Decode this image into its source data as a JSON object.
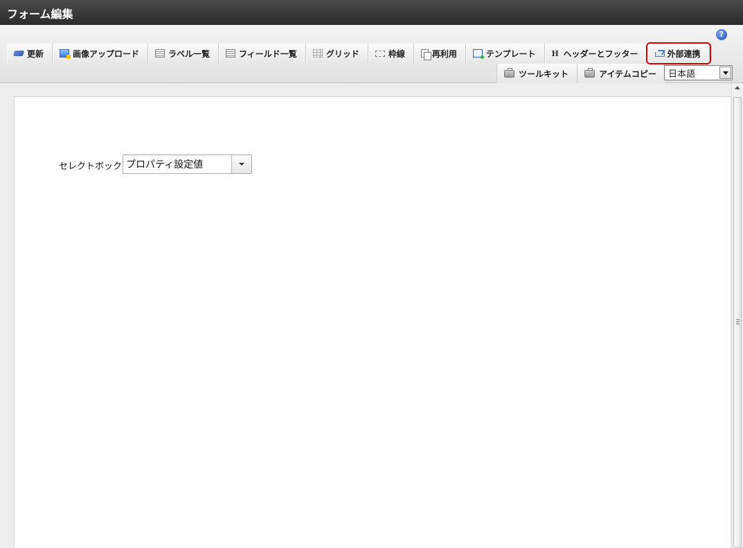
{
  "window": {
    "title": "フォーム編集"
  },
  "toolbar": {
    "tabs": [
      {
        "label": "更新",
        "icon": "update-icon"
      },
      {
        "label": "画像アップロード",
        "icon": "image-upload-icon"
      },
      {
        "label": "ラベル一覧",
        "icon": "list-icon"
      },
      {
        "label": "フィールド一覧",
        "icon": "list-icon"
      },
      {
        "label": "グリッド",
        "icon": "grid-icon"
      },
      {
        "label": "枠線",
        "icon": "frame-icon"
      },
      {
        "label": "再利用",
        "icon": "copy-icon"
      },
      {
        "label": "テンプレート",
        "icon": "template-icon"
      },
      {
        "label": "ヘッダーとフッター",
        "icon": "header-icon",
        "icon_text": "H"
      },
      {
        "label": "外部連携",
        "icon": "external-link-icon",
        "highlighted": true
      }
    ],
    "secondary_tabs": [
      {
        "label": "ツールキット",
        "icon": "toolbox-icon"
      },
      {
        "label": "アイテムコピー",
        "icon": "toolbox-icon"
      }
    ],
    "language": {
      "selected": "日本語"
    },
    "help": {
      "icon": "help-icon",
      "glyph": "?"
    }
  },
  "canvas": {
    "field": {
      "label": "セレクトボックス",
      "value": "プロパティ設定値"
    }
  },
  "colors": {
    "highlight": "#d40000",
    "titlebar": "#2b2b2b"
  }
}
